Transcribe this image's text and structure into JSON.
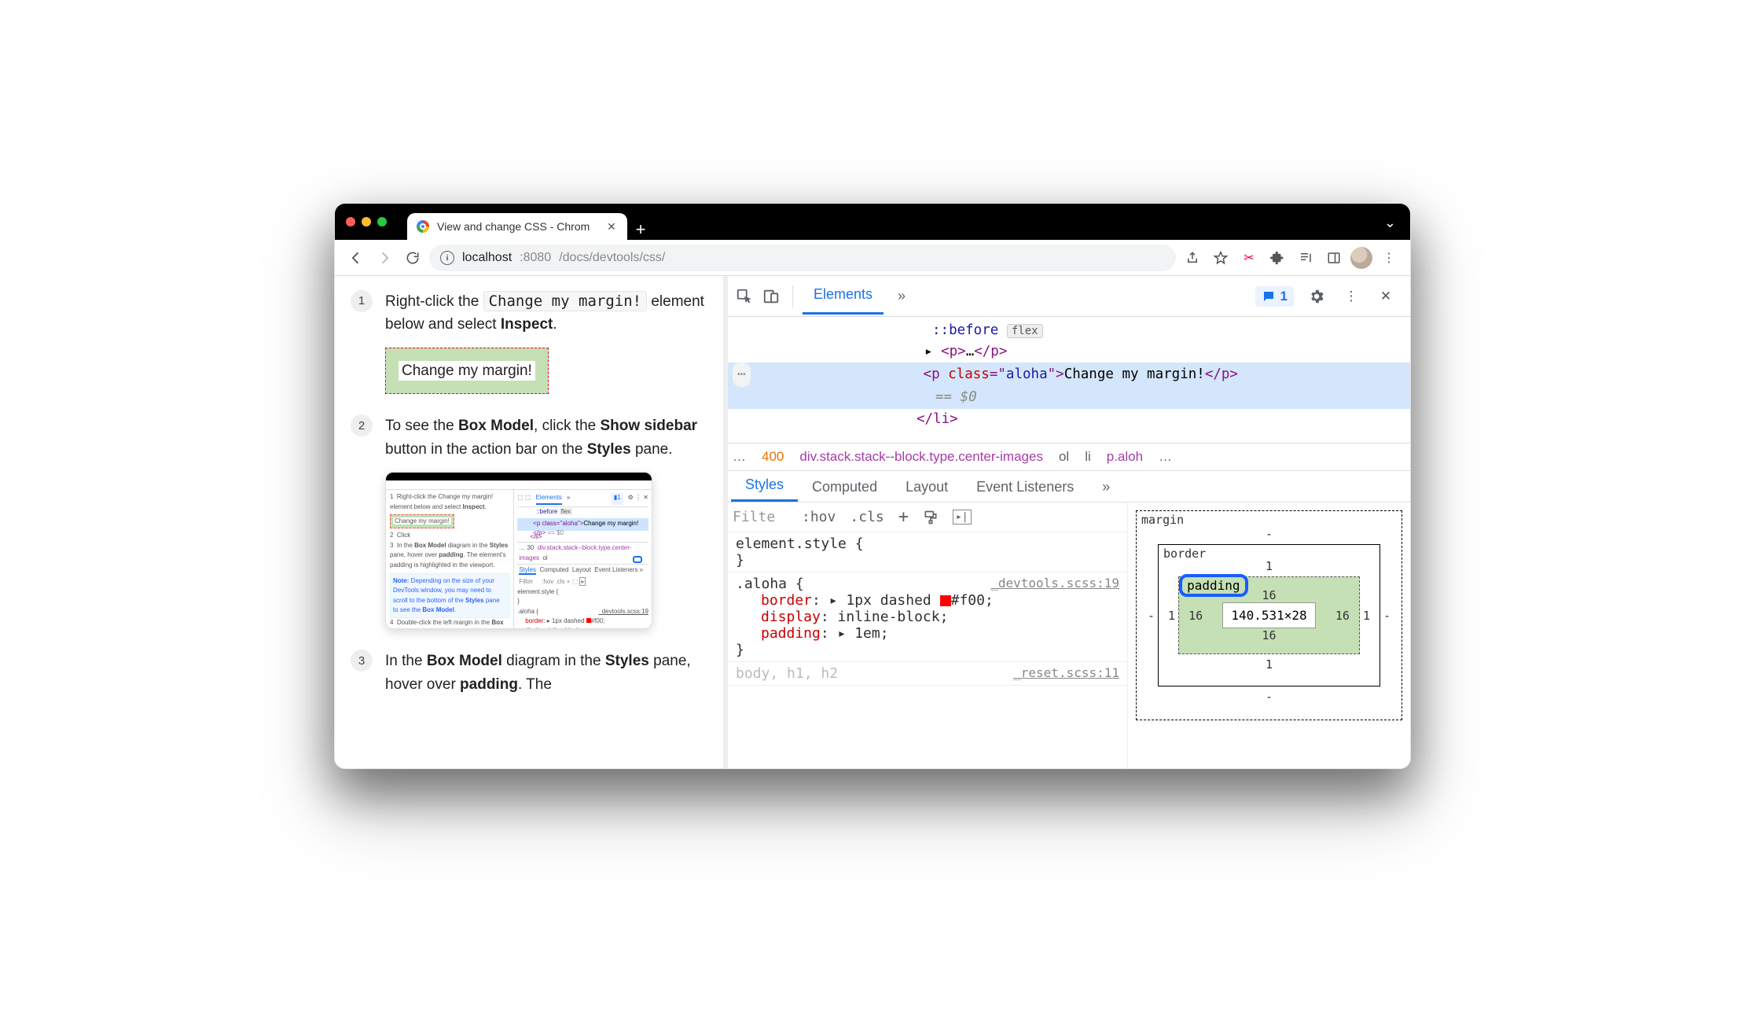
{
  "tab": {
    "title": "View and change CSS - Chrom"
  },
  "url": {
    "host": "localhost",
    "port": ":8080",
    "path": "/docs/devtools/css/"
  },
  "page": {
    "step1": {
      "num": "1",
      "pre": "Right-click the ",
      "code": "Change my margin!",
      "post": " element below and select ",
      "bold": "Inspect",
      "end": ".",
      "box_text": "Change my margin!"
    },
    "step2": {
      "num": "2",
      "t1": "To see the ",
      "b1": "Box Model",
      "t2": ", click the ",
      "b2": "Show sidebar",
      "t3": " button in the action bar on the ",
      "b3": "Styles",
      "t4": " pane."
    },
    "step3": {
      "num": "3",
      "t1": "In the ",
      "b1": "Box Model",
      "t2": " diagram in the ",
      "b2": "Styles",
      "t3": " pane, hover over ",
      "b3": "padding",
      "t4": ". The"
    }
  },
  "devtools": {
    "tabs": {
      "elements": "Elements"
    },
    "msg_count": "1",
    "dom": {
      "before": "::before",
      "flex_badge": "flex",
      "p_collapsed_open": "<p>",
      "p_collapsed_mid": "…",
      "p_collapsed_close": "</p>",
      "sel_open": "<p ",
      "sel_cls_attr": "class",
      "sel_eq": "=\"",
      "sel_cls_val": "aloha",
      "sel_close_attr": "\">",
      "sel_text": "Change my margin!",
      "sel_end": "</p>",
      "dollar": "== $0",
      "li_close": "</li>"
    },
    "crumbs": {
      "ell": "…",
      "num": "400",
      "path": "div.stack.stack--block.type.center-images",
      "ol": "ol",
      "li": "li",
      "p": "p.aloh",
      "more": "…"
    },
    "style_tabs": {
      "styles": "Styles",
      "computed": "Computed",
      "layout": "Layout",
      "listeners": "Event Listeners"
    },
    "filter": {
      "ph": "Filte",
      "hov": ":hov",
      "cls": ".cls"
    },
    "rules": {
      "r0": {
        "sel": "element.style {",
        "close": "}"
      },
      "r1": {
        "sel": ".aloha {",
        "src": "_devtools.scss:19",
        "p1n": "border",
        "p1v": "1px dashed ",
        "p1c": "#f00",
        "p2n": "display",
        "p2v": "inline-block",
        "p3n": "padding",
        "p3v": "1em",
        "close": "}"
      },
      "r2": {
        "sel": "body, h1, h2",
        "src": "_reset.scss:11"
      }
    },
    "box": {
      "margin": "margin",
      "border": "border",
      "padding": "padding",
      "content": "140.531×28",
      "m": "-",
      "bt": "1",
      "pt": "16",
      "pr": "16",
      "pl": "16",
      "pb": "16",
      "bb": "1",
      "bl": "1",
      "br": "1",
      "mb": "-",
      "ml": "-",
      "mr": "-"
    }
  }
}
